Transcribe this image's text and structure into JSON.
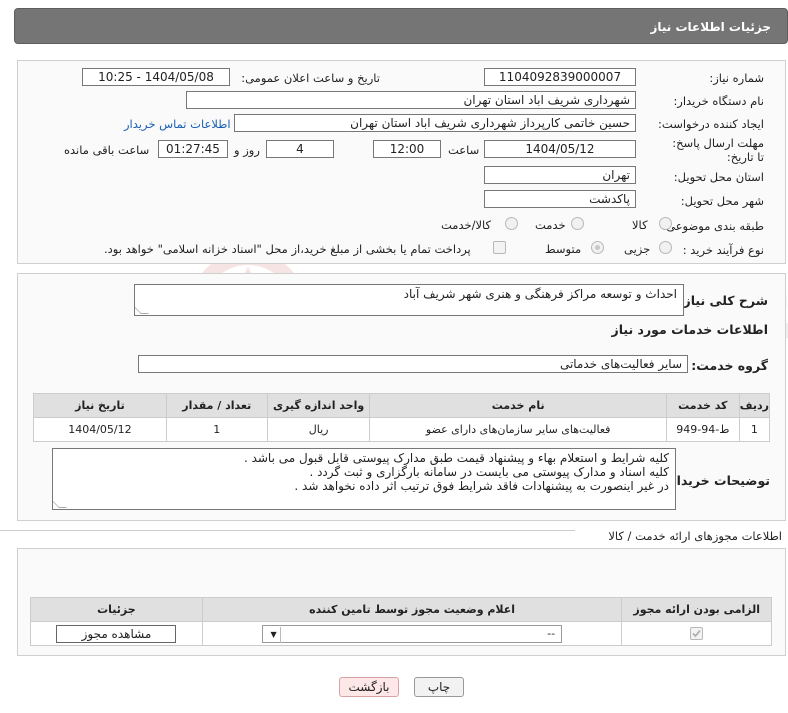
{
  "header": {
    "title": "جزئیات اطلاعات نیاز"
  },
  "form": {
    "need_number_label": "شماره نیاز:",
    "need_number": "1104092839000007",
    "announce_label": "تاریخ و ساعت اعلان عمومی:",
    "announce_value": "1404/05/08 - 10:25",
    "buyer_org_label": "نام دستگاه خریدار:",
    "buyer_org": "شهرداری شریف اباد استان تهران",
    "requester_label": "ایجاد کننده درخواست:",
    "requester": "حسین  خاتمی کارپرداز شهرداری شریف اباد استان تهران",
    "contact_link": "اطلاعات تماس خریدار",
    "deadline_label": "مهلت ارسال پاسخ: تا تاریخ:",
    "deadline_date": "1404/05/12",
    "time_label": "ساعت",
    "deadline_time": "12:00",
    "days_value": "4",
    "days_label": "روز و",
    "remaining_time": "01:27:45",
    "remaining_label": "ساعت باقی مانده",
    "province_label": "استان محل تحویل:",
    "province": "تهران",
    "city_label": "شهر محل تحویل:",
    "city": "پاکدشت",
    "category_label": "طبقه بندی موضوعی:",
    "category_options": [
      "کالا",
      "خدمت",
      "کالا/خدمت"
    ],
    "purchase_label": "نوع فرآیند خرید :",
    "purchase_options": [
      "جزیی",
      "متوسط"
    ],
    "payment_note": "پرداخت تمام یا بخشی از مبلغ خرید،از محل \"اسناد خزانه اسلامی\" خواهد بود."
  },
  "summary": {
    "label": "شرح کلی نیاز:",
    "value": "احداث و توسعه مراکز فرهنگی و هنری شهر شریف آباد"
  },
  "services": {
    "title": "اطلاعات خدمات مورد نیاز",
    "group_label": "گروه خدمت:",
    "group_value": "سایر فعالیت‌های خدماتی",
    "columns": [
      "ردیف",
      "کد خدمت",
      "نام خدمت",
      "واحد اندازه گیری",
      "تعداد / مقدار",
      "تاریخ نیاز"
    ],
    "rows": [
      [
        "1",
        "ط-94-949",
        "فعالیت‌های سایر سازمان‌های دارای عضو",
        "ریال",
        "1",
        "1404/05/12"
      ]
    ]
  },
  "buyer_notes": {
    "label": "توضیحات خریدار:",
    "lines": [
      "کلیه شرایط و استعلام بهاء و پیشنهاد قیمت طبق مدارک پیوستی قابل قبول می باشد .",
      "کلیه اسناد و مدارک پیوستی می بایست در سامانه بارگزاری و ثبت گردد .",
      "در غیر اینصورت به پیشنهادات فاقد شرایط فوق ترتیب اثر داده نخواهد شد ."
    ]
  },
  "permits": {
    "title": "اطلاعات مجوزهای ارائه خدمت / کالا",
    "columns": [
      "الزامی بودن ارائه مجوز",
      "اعلام وضعیت مجوز توسط تامین کننده",
      "جزئیات"
    ],
    "select_value": "--",
    "view_button": "مشاهده مجوز"
  },
  "buttons": {
    "print": "چاپ",
    "back": "بازگشت"
  },
  "watermark": {
    "text": "AriaTender.neT"
  }
}
